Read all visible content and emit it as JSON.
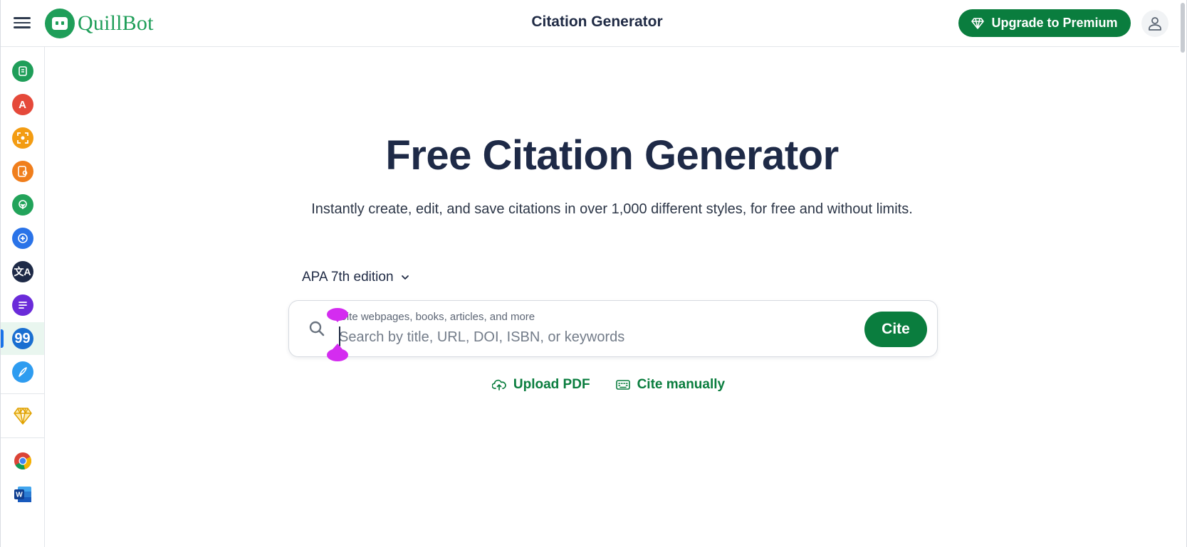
{
  "header": {
    "logo_text": "QuillBot",
    "title": "Citation Generator",
    "premium_label": "Upgrade to Premium",
    "icons": {
      "menu": "hamburger-menu-icon",
      "premium": "diamond-icon",
      "user": "user-icon"
    }
  },
  "sidebar": {
    "items": [
      {
        "name": "paraphraser",
        "icon": "paraphrase-icon",
        "color": "#1f9e59"
      },
      {
        "name": "grammar-checker",
        "icon": "grammar-icon",
        "color": "#e5493a"
      },
      {
        "name": "ai-detector",
        "icon": "ai-detect-icon",
        "color": "#f39c12"
      },
      {
        "name": "plagiarism-checker",
        "icon": "plagiarism-icon",
        "color": "#f07e1c"
      },
      {
        "name": "ai-humanizer",
        "icon": "humanizer-icon",
        "color": "#22a35a"
      },
      {
        "name": "ai-chat",
        "icon": "chat-plus-icon",
        "color": "#2a73e8"
      },
      {
        "name": "translator",
        "icon": "translate-icon",
        "color": "#1e2a47"
      },
      {
        "name": "summarizer",
        "icon": "summarize-icon",
        "color": "#6a2bd9"
      },
      {
        "name": "citation-generator",
        "icon": "quote-icon",
        "color": "#1a6fd1",
        "active": true
      },
      {
        "name": "ai-writer",
        "icon": "quill-icon",
        "color": "#2e9cf0"
      }
    ],
    "premium_icon": "gem-icon",
    "extensions": [
      "chrome-icon",
      "word-icon"
    ]
  },
  "main": {
    "heading": "Free Citation Generator",
    "subheading": "Instantly create, edit, and save citations in over 1,000 different styles, for free and without limits.",
    "style_select": "APA 7th edition",
    "search": {
      "label": "Cite webpages, books, articles, and more",
      "placeholder": "Search by title, URL, DOI, ISBN, or keywords",
      "value": "",
      "button": "Cite"
    },
    "actions": {
      "upload": "Upload PDF",
      "manual": "Cite manually"
    }
  },
  "colors": {
    "brand_green": "#1f9e59",
    "button_green": "#0a7d3e",
    "heading": "#1e2a47",
    "selection_handle": "#d42cf0"
  }
}
